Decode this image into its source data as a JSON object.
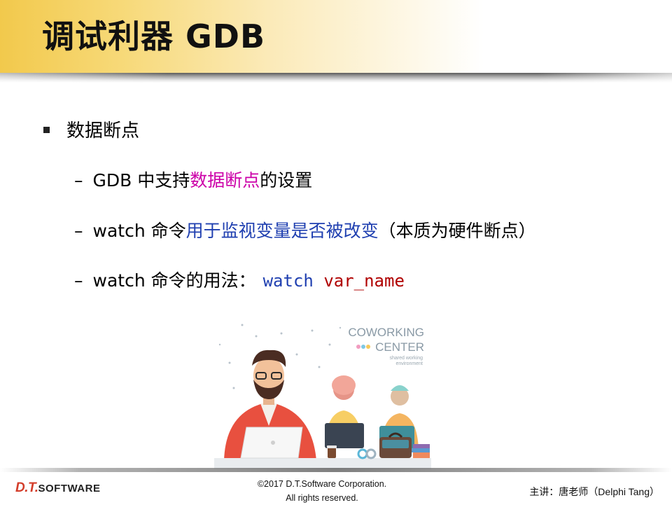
{
  "slide": {
    "title": "调试利器 GDB",
    "bullet_main": "数据断点",
    "items": [
      {
        "prefix": "GDB 中支持",
        "highlight": "数据断点",
        "suffix": "的设置"
      },
      {
        "prefix": "watch 命令",
        "highlight": "用于监视变量是否被改变",
        "suffix": "（本质为硬件断点）"
      },
      {
        "prefix": "watch 命令的用法：",
        "code_keyword": "watch",
        "code_arg": "var_name"
      }
    ],
    "dash": "–"
  },
  "illustration": {
    "sign_line1": "COWORKING",
    "sign_line2": "CENTER",
    "sign_sub1": "shared working",
    "sign_sub2": "environment"
  },
  "footer": {
    "logo_dt": "D.T.",
    "logo_software": "SOFTWARE",
    "copyright_line1": "©2017 D.T.Software Corporation.",
    "copyright_line2": "All rights reserved.",
    "presenter": "主讲：唐老师（Delphi Tang）"
  },
  "colors": {
    "title_band": "#f2c94c",
    "highlight_magenta": "#cc00a8",
    "highlight_blue": "#1f3fb0",
    "code_arg": "#b00000",
    "logo_red": "#d33d2a"
  }
}
